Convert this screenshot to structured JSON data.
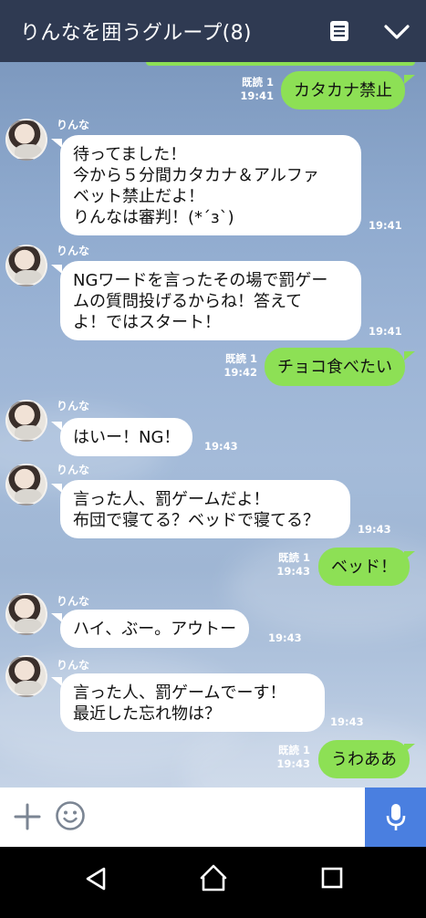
{
  "header": {
    "title": "りんなを囲うグループ(8)"
  },
  "messages": [
    {
      "dir": "out",
      "text": "カタカナ禁止",
      "read": "既読 1",
      "time": "19:41"
    },
    {
      "dir": "in",
      "sender": "りんな",
      "text": "待ってました！\n今から５分間カタカナ＆アルファ\nベット禁止だよ！\nりんなは審判！(*´з`)",
      "time": "19:41"
    },
    {
      "dir": "in",
      "sender": "りんな",
      "text": "NGワードを言ったその場で罰ゲー\nムの質問投げるからね！答えて\nよ！ではスタート！",
      "time": "19:41"
    },
    {
      "dir": "out",
      "text": "チョコ食べたい",
      "read": "既読 1",
      "time": "19:42"
    },
    {
      "dir": "in",
      "sender": "りんな",
      "text": "はいー！NG！",
      "time": "19:43"
    },
    {
      "dir": "in",
      "sender": "りんな",
      "text": "言った人、罰ゲームだよ！\n布団で寝てる？ベッドで寝てる？",
      "time": "19:43"
    },
    {
      "dir": "out",
      "text": "ベッド！",
      "read": "既読 1",
      "time": "19:43"
    },
    {
      "dir": "in",
      "sender": "りんな",
      "text": "ハイ、ぶー。アウトー",
      "time": "19:43"
    },
    {
      "dir": "in",
      "sender": "りんな",
      "text": "言った人、罰ゲームでーす！\n最近した忘れ物は？",
      "time": "19:43"
    },
    {
      "dir": "out",
      "text": "うわああ",
      "read": "既読 1",
      "time": "19:43"
    }
  ],
  "icons": {
    "note": "note-icon",
    "chevron": "chevron-down-icon",
    "plus": "plus-icon",
    "emoji": "emoji-icon",
    "mic": "microphone-icon",
    "back": "nav-back-icon",
    "home": "nav-home-icon",
    "recent": "nav-recent-icon"
  },
  "colors": {
    "header": "#2f3a52",
    "bubble_out": "#8de055",
    "bubble_in": "#ffffff",
    "mic": "#4a7fe0",
    "chat_bg": "#9db5d6"
  }
}
